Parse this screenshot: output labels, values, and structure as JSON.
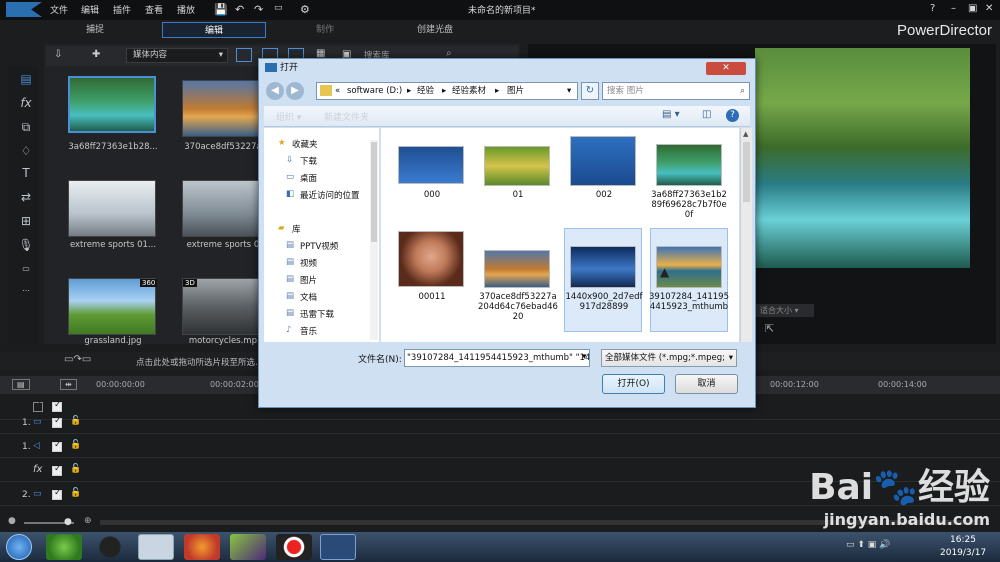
{
  "app": {
    "brand": "PowerDirector",
    "project_title": "未命名的新项目*",
    "menu": [
      "文件",
      "编辑",
      "插件",
      "查看",
      "播放"
    ],
    "modes": [
      "捕捉",
      "编辑",
      "制作",
      "创建光盘"
    ]
  },
  "media": {
    "dropdown": "媒体内容",
    "search_placeholder": "搜索库",
    "items": [
      {
        "label": "3a68ff27363e1b28..."
      },
      {
        "label": "370ace8df53227a..."
      },
      {
        "label": "extreme sports 01..."
      },
      {
        "label": "extreme sports 0..."
      },
      {
        "label": "grassland.jpg",
        "badge": "360"
      },
      {
        "label": "motorcycles.mp...",
        "badge": "3D"
      }
    ]
  },
  "preview": {
    "fit_label": "适合大小"
  },
  "timeline": {
    "hint": "点击此处或拖动所选片段至所选...",
    "times": [
      "00:00:00:00",
      "00:00:02:00",
      "00:00:12:00",
      "00:00:14:00"
    ],
    "tracks": [
      "1.",
      "1.",
      "fx",
      "2."
    ]
  },
  "dialog": {
    "title": "打开",
    "address": [
      "«",
      "software (D:)",
      "经验",
      "经验素材",
      "图片"
    ],
    "search_placeholder": "搜索 图片",
    "organize": "组织 ▾",
    "new_folder": "新建文件夹",
    "nav": {
      "favorites": "收藏夹",
      "fav_items": [
        "下载",
        "桌面",
        "最近访问的位置"
      ],
      "library": "库",
      "lib_items": [
        "PPTV视频",
        "视频",
        "图片",
        "文档",
        "迅雷下载",
        "音乐"
      ]
    },
    "files": [
      {
        "name": "000"
      },
      {
        "name": "01"
      },
      {
        "name": "002"
      },
      {
        "name": "3a68ff27363e1b289f69628c7b7f0e0f"
      },
      {
        "name": "00011"
      },
      {
        "name": "370ace8df53227a204d64c76ebad4620"
      },
      {
        "name": "1440x900_2d7edf917d28899"
      },
      {
        "name": "39107284_1411954415923_mthumb"
      }
    ],
    "filename_label": "文件名(N):",
    "filename_value": "\"39107284_1411954415923_mthumb\" \"14",
    "filetype": "全部媒体文件 (*.mpg;*.mpeg;",
    "open": "打开(O)",
    "cancel": "取消"
  },
  "taskbar": {
    "time": "16:25",
    "date": "2019/3/17"
  },
  "watermark": {
    "brand": "Bai",
    "brand2": "经验",
    "url": "jingyan.baidu.com"
  }
}
